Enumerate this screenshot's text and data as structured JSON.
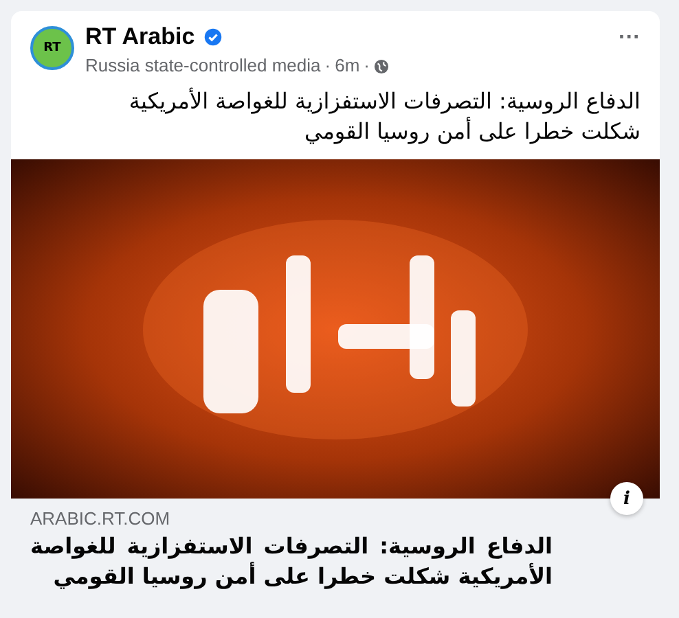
{
  "post": {
    "avatar_text": "RT",
    "author": "RT Arabic",
    "verified": true,
    "subtitle": "Russia state-controlled media",
    "separator": "·",
    "time": "6m",
    "more": "···",
    "text": "الدفاع الروسية: التصرفات الاستفزازية للغواصة الأمريكية شكلت خطرا على أمن روسيا القومي"
  },
  "link_preview": {
    "info": "i",
    "domain": "ARABIC.RT.COM",
    "title": "الدفاع الروسية: التصرفات الاستفزازية للغواصة الأمريكية شكلت خطرا على أمن روسيا القومي"
  }
}
